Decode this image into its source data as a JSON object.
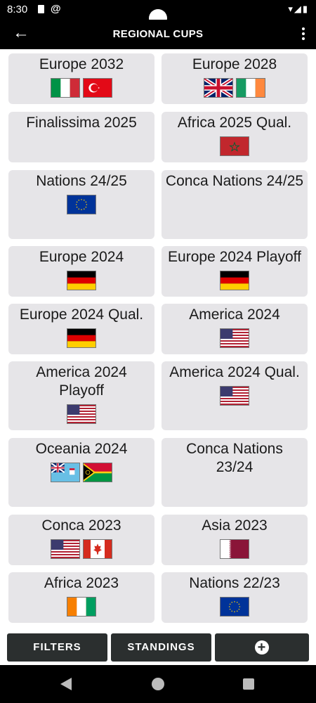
{
  "status": {
    "time": "8:30",
    "at_symbol": "@",
    "right_icons": "▾◢▮"
  },
  "toolbar": {
    "title": "REGIONAL CUPS",
    "back_glyph": "←"
  },
  "cards": [
    {
      "title": "Europe 2032",
      "flags": [
        "italy",
        "turkey"
      ]
    },
    {
      "title": "Europe 2028",
      "flags": [
        "uk",
        "ireland"
      ]
    },
    {
      "title": "Finalissima 2025",
      "flags": []
    },
    {
      "title": "Africa 2025 Qual.",
      "flags": [
        "morocco"
      ]
    },
    {
      "title": "Nations 24/25",
      "flags": [
        "eu"
      ]
    },
    {
      "title": "Conca Nations 24/25",
      "flags": []
    },
    {
      "title": "Europe 2024",
      "flags": [
        "germany"
      ]
    },
    {
      "title": "Europe 2024 Playoff",
      "flags": [
        "germany"
      ]
    },
    {
      "title": "Europe 2024 Qual.",
      "flags": [
        "germany"
      ]
    },
    {
      "title": "America 2024",
      "flags": [
        "usa"
      ]
    },
    {
      "title": "America 2024 Playoff",
      "flags": [
        "usa"
      ]
    },
    {
      "title": "America 2024 Qual.",
      "flags": [
        "usa"
      ]
    },
    {
      "title": "Oceania 2024",
      "flags": [
        "fiji",
        "vanuatu"
      ]
    },
    {
      "title": "Conca Nations 23/24",
      "flags": []
    },
    {
      "title": "Conca 2023",
      "flags": [
        "usa",
        "canada"
      ]
    },
    {
      "title": "Asia 2023",
      "flags": [
        "qatar"
      ]
    },
    {
      "title": "Africa 2023",
      "flags": [
        "ivory-coast"
      ]
    },
    {
      "title": "Nations 22/23",
      "flags": [
        "eu"
      ]
    }
  ],
  "buttons": {
    "filters": "FILTERS",
    "standings": "STANDINGS",
    "add": "+"
  },
  "colors": {
    "card_bg": "#e6e5e8",
    "button_bg": "#2b2f2f",
    "bar_bg": "#000000"
  }
}
